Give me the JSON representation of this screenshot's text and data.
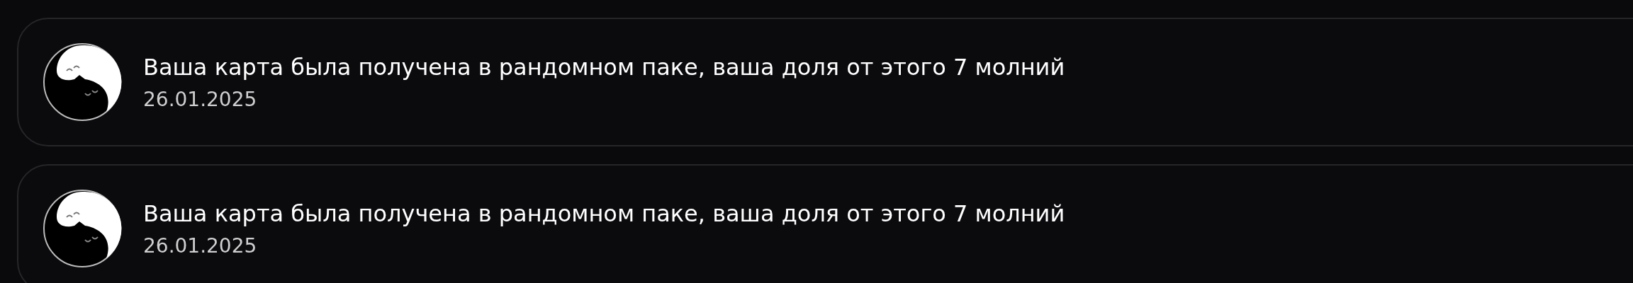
{
  "notifications": [
    {
      "message": "Ваша карта была получена в рандомном паке, ваша доля от этого 7 молний",
      "date": "26.01.2025"
    },
    {
      "message": "Ваша карта была получена в рандомном паке, ваша доля от этого 7 молний",
      "date": "26.01.2025"
    }
  ]
}
